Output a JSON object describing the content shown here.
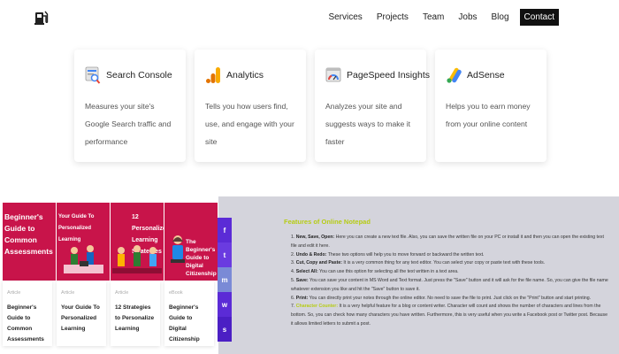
{
  "nav": {
    "logo_icon": "fuel-pump-icon",
    "links": [
      "Services",
      "Projects",
      "Team",
      "Jobs",
      "Blog"
    ],
    "cta": "Contact"
  },
  "cards": [
    {
      "title": "Search Console",
      "icon": "search-console-icon",
      "desc": "Measures your site's Google Search traffic and performance"
    },
    {
      "title": "Analytics",
      "icon": "analytics-icon",
      "desc": "Tells you how users find, use, and engage with your site"
    },
    {
      "title": "PageSpeed Insights",
      "icon": "pagespeed-icon",
      "desc": "Analyzes your site and suggests ways to make it faster"
    },
    {
      "title": "AdSense",
      "icon": "adsense-icon",
      "desc": "Helps you to earn money from your online content"
    }
  ],
  "posts": [
    {
      "thumb": "Beginner's Guide to Common Assessments",
      "meta": "Article",
      "title": "Beginner's Guide to Common Assessments"
    },
    {
      "thumb": "Your Guide To Personalized Learning",
      "meta": "Article",
      "title": "Your Guide To Personalized Learning"
    },
    {
      "thumb": "12 Personalized Learning Strategies",
      "meta": "Article",
      "title": "12 Strategies to Personalize Learning"
    },
    {
      "thumb": "The Beginner's Guide to Digital Citizenship",
      "meta": "eBook",
      "title": "Beginner's Guide to Digital Citizenship"
    }
  ],
  "share": [
    "f",
    "t",
    "m",
    "w",
    "s"
  ],
  "article": {
    "heading": "Features of Online Notepad",
    "steps": [
      {
        "label": "New, Save, Open:",
        "text": " Here you can create a new text file. Also, you can save the written file on your PC or install it and then you can open the existing text file and edit it here."
      },
      {
        "label": "Undo & Redo:",
        "text": " These two options will help you to move forward or backward the written text."
      },
      {
        "label": "Cut, Copy and Paste:",
        "text": " It is a very common thing for any text editor. You can select your copy or paste text with these tools."
      },
      {
        "label": "Select All:",
        "text": " You can use this option for selecting all the text written in a text area."
      },
      {
        "label": "Save:",
        "text": " You can save your content in MS Word and Text format. Just press the \"Save\" button and it will ask for the file name. So, you can give the file name whatever extension you like and hit the \"Save\" button to save it."
      },
      {
        "label": "Print:",
        "text": " You can directly print your notes through the online editor. No need to save the file to print. Just click on the \"Print\" button and start printing."
      },
      {
        "label": "Character Counter:",
        "text": " It is a very helpful feature for a blog or content writer. Character will count and shows the number of characters and lines from the bottom. So, you can check how many characters you have written. Furthermore, this is very useful when you write a Facebook post or Twitter post. Because it allows limited letters to submit a post."
      }
    ]
  }
}
